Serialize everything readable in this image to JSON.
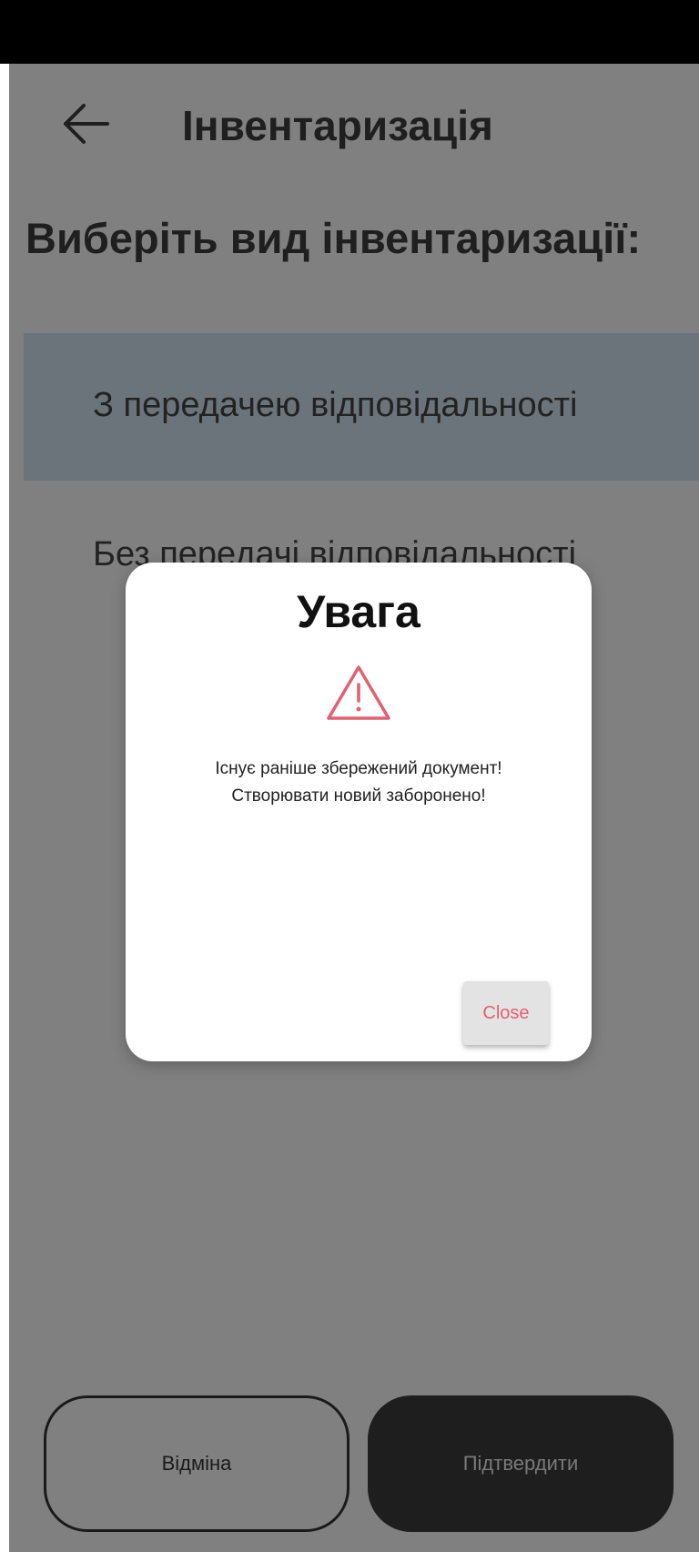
{
  "app_bar": {
    "title": "Інвентаризація",
    "back_icon": "arrow-left-icon"
  },
  "section_title": "Виберіть вид інвентаризації:",
  "options": [
    {
      "label": "З передачею відповідальності",
      "selected": true
    },
    {
      "label": "Без передачі відповідальності",
      "selected": false
    }
  ],
  "actions": {
    "cancel_label": "Відміна",
    "confirm_label": "Підтвердити"
  },
  "dialog": {
    "title": "Увага",
    "icon": "warning-triangle-icon",
    "message_line1": "Існує раніше збережений документ!",
    "message_line2": "Створювати новий заборонено!",
    "close_label": "Close"
  },
  "colors": {
    "overlay_background": "#808080",
    "selected_option": "#6b747b",
    "warning_accent": "#e2606f",
    "confirm_button": "#1e1e1e"
  }
}
